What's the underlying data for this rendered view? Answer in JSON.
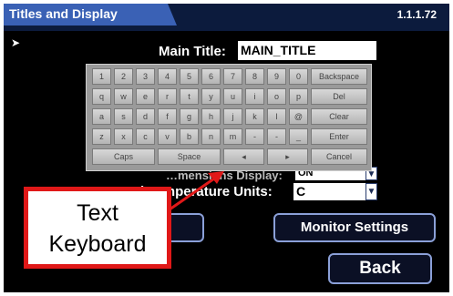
{
  "header": {
    "title": "Titles and Display",
    "version": "1.1.1.72"
  },
  "main_title": {
    "label": "Main Title:",
    "value": "MAIN_TITLE"
  },
  "hidden_row": {
    "label_fragment": "…mensions Display:",
    "value_fragment": "ON"
  },
  "temp_units": {
    "label": "Internal Temperature Units:",
    "value": "C"
  },
  "keyboard": {
    "rows": [
      [
        "1",
        "2",
        "3",
        "4",
        "5",
        "6",
        "7",
        "8",
        "9",
        "0",
        "Backspace"
      ],
      [
        "q",
        "w",
        "e",
        "r",
        "t",
        "y",
        "u",
        "i",
        "o",
        "p",
        "Del"
      ],
      [
        "a",
        "s",
        "d",
        "f",
        "g",
        "h",
        "j",
        "k",
        "l",
        "@",
        "Clear"
      ],
      [
        "z",
        "x",
        "c",
        "v",
        "b",
        "n",
        "m",
        "-",
        "-",
        "_",
        "Enter"
      ],
      [
        "Caps",
        "Space",
        "◂",
        "▸",
        "Cancel"
      ]
    ]
  },
  "buttons": {
    "monitor_settings": "Monitor Settings",
    "back": "Back"
  },
  "callout": {
    "line1": "Text",
    "line2": "Keyboard"
  },
  "colors": {
    "header_tab": "#3a61b5",
    "callout_border": "#e01818",
    "button_border": "#8ba0d8"
  }
}
